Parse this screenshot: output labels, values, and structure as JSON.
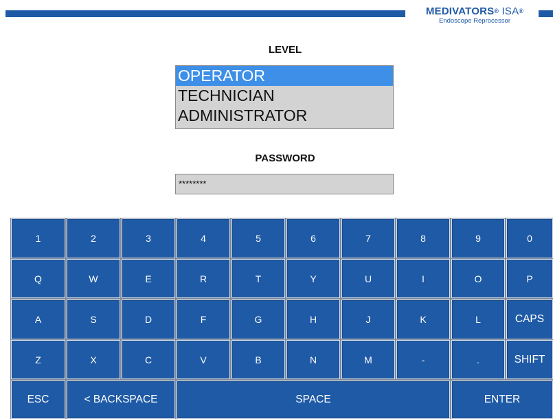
{
  "brand": {
    "name": "MEDIVATORS",
    "reg_mark": "®",
    "product": "ISA",
    "product_reg_mark": "®",
    "subtitle": "Endoscope Reprocessor",
    "color": "#1f5aa6"
  },
  "level": {
    "title": "LEVEL",
    "options": [
      "OPERATOR",
      "TECHNICIAN",
      "ADMINISTRATOR"
    ],
    "selected": "OPERATOR"
  },
  "password": {
    "title": "PASSWORD",
    "value": "********"
  },
  "keyboard": {
    "key_color": "#1f5aa6",
    "rows": [
      [
        "1",
        "2",
        "3",
        "4",
        "5",
        "6",
        "7",
        "8",
        "9",
        "0"
      ],
      [
        "Q",
        "W",
        "E",
        "R",
        "T",
        "Y",
        "U",
        "I",
        "O",
        "P"
      ],
      [
        "A",
        "S",
        "D",
        "F",
        "G",
        "H",
        "J",
        "K",
        "L",
        "CAPS"
      ],
      [
        "Z",
        "X",
        "C",
        "V",
        "B",
        "N",
        "M",
        "-",
        ".",
        "SHIFT"
      ],
      [
        "ESC",
        "< BACKSPACE",
        "SPACE",
        "ENTER"
      ]
    ]
  }
}
